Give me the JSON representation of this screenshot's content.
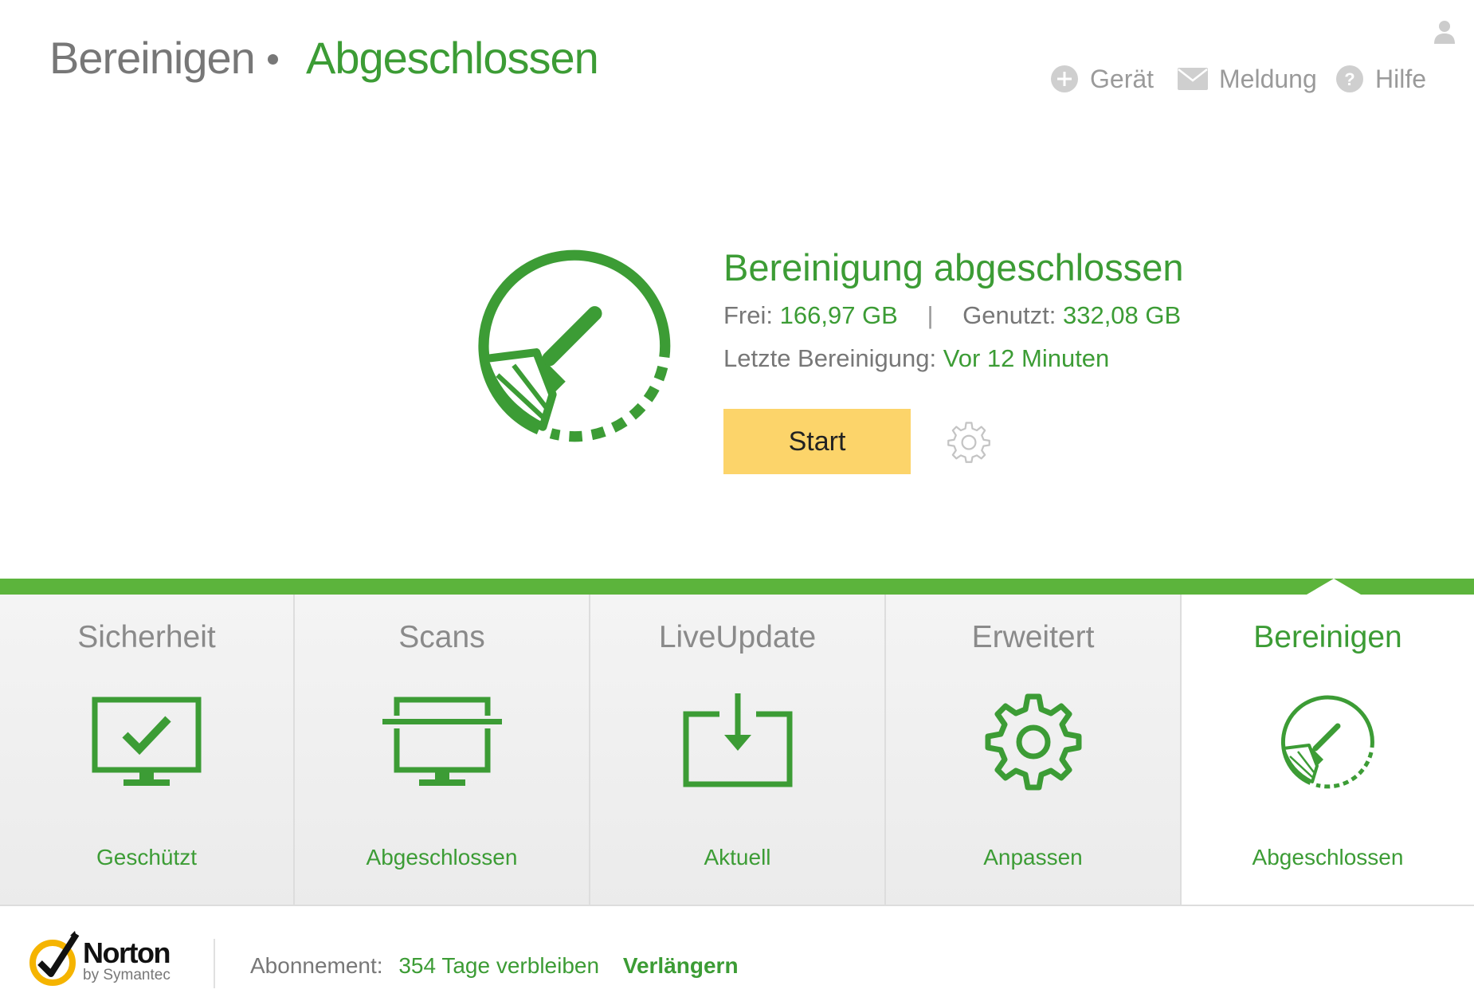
{
  "header": {
    "section": "Bereinigen",
    "status": "Abgeschlossen",
    "nav": [
      {
        "label": "Gerät",
        "icon": "plus-circle-icon"
      },
      {
        "label": "Meldung",
        "icon": "envelope-icon"
      },
      {
        "label": "Hilfe",
        "icon": "question-circle-icon"
      }
    ],
    "user_icon": "user-icon"
  },
  "hero": {
    "title": "Bereinigung abgeschlossen",
    "free_label": "Frei:",
    "free_value": "166,97 GB",
    "separator": "|",
    "used_label": "Genutzt:",
    "used_value": "332,08 GB",
    "last_label": "Letzte Bereinigung:",
    "last_value": "Vor 12 Minuten",
    "start_label": "Start",
    "settings_icon": "gear-icon"
  },
  "tabs": [
    {
      "name": "Sicherheit",
      "status": "Geschützt",
      "icon": "monitor-check-icon",
      "active": false
    },
    {
      "name": "Scans",
      "status": "Abgeschlossen",
      "icon": "monitor-scan-icon",
      "active": false
    },
    {
      "name": "LiveUpdate",
      "status": "Aktuell",
      "icon": "download-tray-icon",
      "active": false
    },
    {
      "name": "Erweitert",
      "status": "Anpassen",
      "icon": "gear-icon",
      "active": false
    },
    {
      "name": "Bereinigen",
      "status": "Abgeschlossen",
      "icon": "broom-icon",
      "active": true
    }
  ],
  "footer": {
    "brand": "Norton",
    "brand_sub": "by Symantec",
    "subscription_label": "Abonnement:",
    "subscription_value": "354 Tage verbleiben",
    "renew_label": "Verlängern"
  },
  "colors": {
    "accent_green": "#3c9c35",
    "tab_bar_green": "#5cb43c",
    "start_button": "#fcd46a",
    "text_gray": "#777777"
  }
}
